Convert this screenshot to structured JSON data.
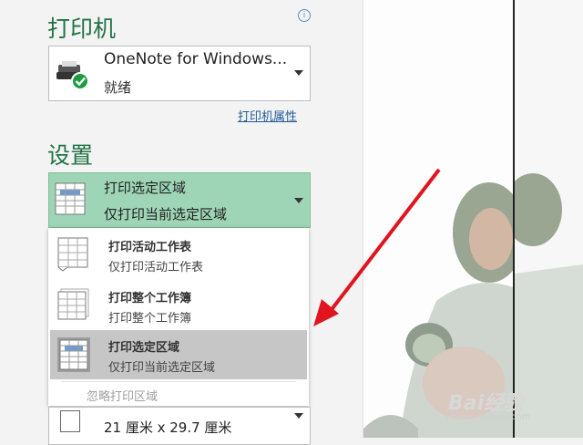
{
  "printer": {
    "title": "打印机",
    "info_glyph": "i",
    "name": "OneNote for Windows...",
    "status": "就绪",
    "properties_link": "打印机属性"
  },
  "settings": {
    "title": "设置",
    "selected": {
      "label": "打印选定区域",
      "description": "仅打印当前选定区域"
    },
    "options": [
      {
        "label": "打印活动工作表",
        "description": "仅打印活动工作表"
      },
      {
        "label": "打印整个工作簿",
        "description": "打印整个工作簿"
      },
      {
        "label": "打印选定区域",
        "description": "仅打印当前选定区域",
        "selected": true
      }
    ],
    "ignore_print_area": "忽略打印区域"
  },
  "paper": {
    "size": "21 厘米 x 29.7 厘米"
  },
  "watermark": {
    "brand": "Bai经验",
    "url": "jingyan.baidu.com"
  },
  "colors": {
    "accent": "#217346",
    "selected_bg": "#9fd5b7",
    "arrow": "#e0151f"
  }
}
